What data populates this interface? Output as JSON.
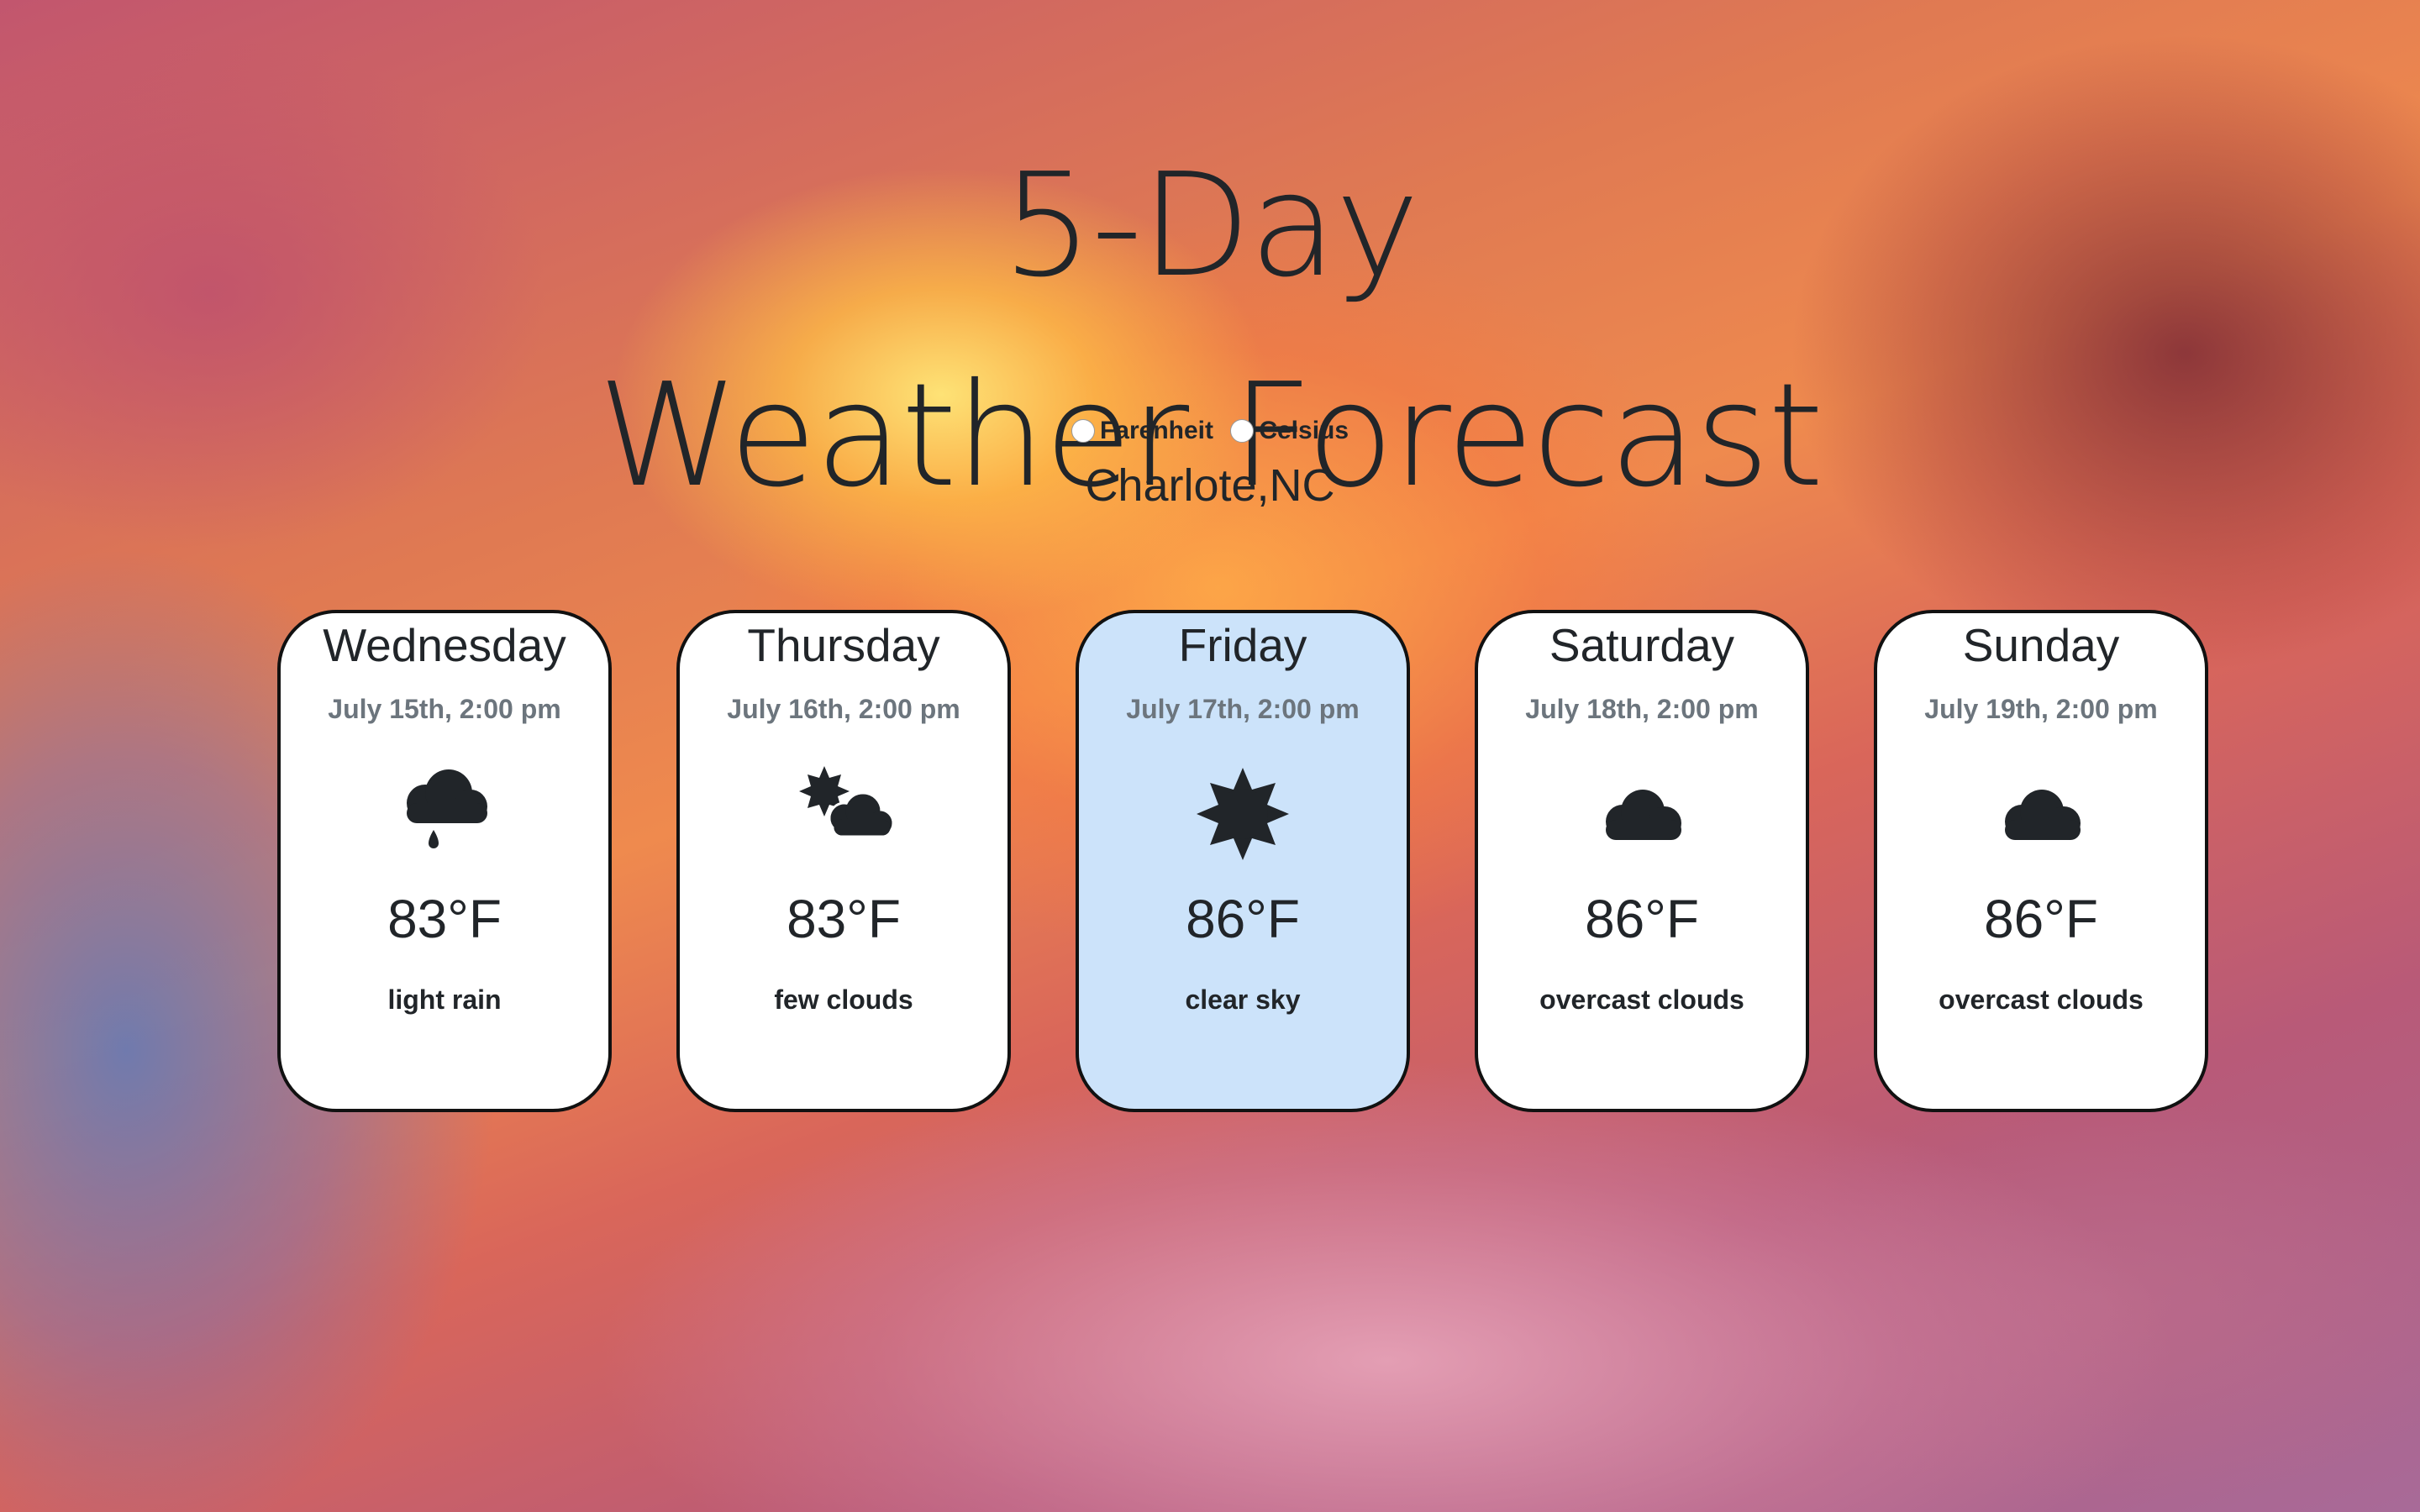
{
  "title": {
    "line1": "5-Day",
    "line2": "Weather Forecast"
  },
  "units": {
    "fahrenheit_label": "Farenheit",
    "celsius_label": "Celsius"
  },
  "city": "Charlote,NC",
  "colors": {
    "text": "#212529",
    "muted_text": "#6c757d",
    "card_background": "#ffffff",
    "active_card_background": "#cce3fa",
    "card_border": "#111111"
  },
  "forecast": [
    {
      "day": "Wednesday",
      "date": "July 15th, 2:00 pm",
      "icon": "rain-cloud-icon",
      "temp": "83°F",
      "description": "light rain",
      "active": false
    },
    {
      "day": "Thursday",
      "date": "July 16th, 2:00 pm",
      "icon": "sun-cloud-icon",
      "temp": "83°F",
      "description": "few clouds",
      "active": false
    },
    {
      "day": "Friday",
      "date": "July 17th, 2:00 pm",
      "icon": "sun-icon",
      "temp": "86°F",
      "description": "clear sky",
      "active": true
    },
    {
      "day": "Saturday",
      "date": "July 18th, 2:00 pm",
      "icon": "cloud-icon",
      "temp": "86°F",
      "description": "overcast clouds",
      "active": false
    },
    {
      "day": "Sunday",
      "date": "July 19th, 2:00 pm",
      "icon": "cloud-icon",
      "temp": "86°F",
      "description": "overcast clouds",
      "active": false
    }
  ]
}
